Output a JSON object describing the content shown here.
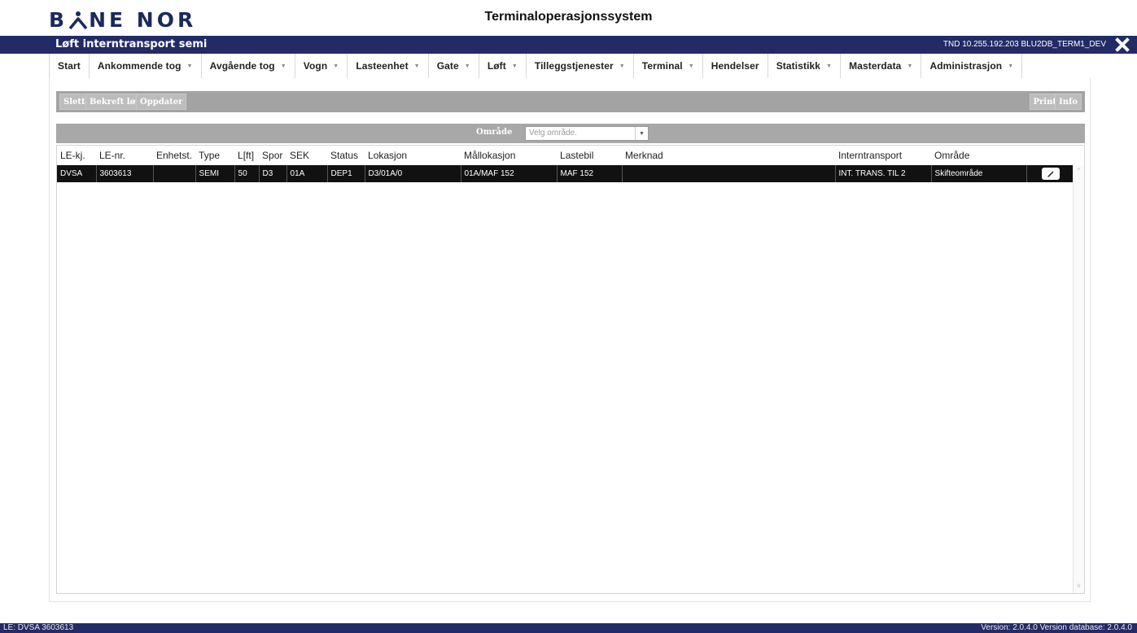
{
  "brand": {
    "part1": "B",
    "part2": "NE NOR"
  },
  "system_title": "Terminaloperasjonssystem",
  "appbar": {
    "window_title": "Løft interntransport semi",
    "connection_info": "TND 10.255.192.203 BLU2DB_TERM1_DEV",
    "close_icon": "close-x-icon"
  },
  "menu": [
    {
      "label": "Start",
      "dropdown": false
    },
    {
      "label": "Ankommende tog",
      "dropdown": true
    },
    {
      "label": "Avgående tog",
      "dropdown": true
    },
    {
      "label": "Vogn",
      "dropdown": true
    },
    {
      "label": "Lasteenhet",
      "dropdown": true
    },
    {
      "label": "Gate",
      "dropdown": true
    },
    {
      "label": "Løft",
      "dropdown": true
    },
    {
      "label": "Tilleggstjenester",
      "dropdown": true
    },
    {
      "label": "Terminal",
      "dropdown": true
    },
    {
      "label": "Hendelser",
      "dropdown": false
    },
    {
      "label": "Statistikk",
      "dropdown": true
    },
    {
      "label": "Masterdata",
      "dropdown": true
    },
    {
      "label": "Administrasjon",
      "dropdown": true
    }
  ],
  "toolbar": {
    "delete_label": "Slett",
    "confirm_label": "Bekreft løft",
    "update_label": "Oppdater",
    "print_label": "Print",
    "info_label": "Info"
  },
  "filter": {
    "label": "Område",
    "placeholder": "Velg område."
  },
  "table": {
    "columns": [
      "LE-kj.",
      "LE-nr.",
      "Enhetst.",
      "Type",
      "L[ft]",
      "Spor",
      "SEK",
      "Status",
      "Lokasjon",
      "Mållokasjon",
      "Lastebil",
      "Merknad",
      "Interntransport",
      "Område",
      ""
    ],
    "rows": [
      [
        "DVSA",
        "3603613",
        "",
        "SEMI",
        "50",
        "D3",
        "01A",
        "DEP1",
        "D3/01A/0",
        "01A/MAF 152",
        "MAF 152",
        "",
        "INT. TRANS. TIL 2",
        "Skifteområde",
        ""
      ]
    ]
  },
  "statusbar": {
    "left": "LE: DVSA 3603613",
    "right": "Version: 2.0.4.0 Version database: 2.0.4.0"
  },
  "colors": {
    "appbar": "#232b66",
    "brand": "#1b2a5c",
    "toolbar": "#a3a3a3",
    "selected_row": "#111111"
  }
}
